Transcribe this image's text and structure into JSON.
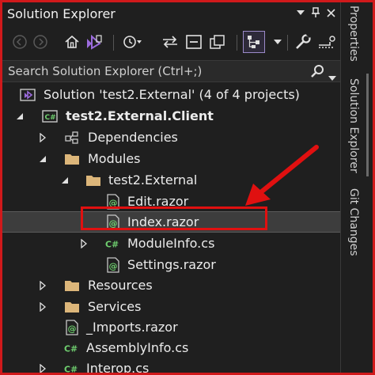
{
  "panel": {
    "title": "Solution Explorer",
    "search": {
      "placeholder": "Search Solution Explorer (Ctrl+;)"
    }
  },
  "toolbar": {
    "buttons": [
      "back-icon",
      "forward-icon",
      "home-icon",
      "switch-views-icon",
      "history-icon",
      "sync-icon",
      "collapse-all-icon",
      "show-all-files-icon",
      "preview-icon",
      "properties-wrench-icon",
      "settings-icon"
    ]
  },
  "tree": {
    "solution": "Solution 'test2.External' (4 of 4 projects)",
    "project": "test2.External.Client",
    "dependencies": "Dependencies",
    "modules": "Modules",
    "module_folder": "test2.External",
    "edit": "Edit.razor",
    "index": "Index.razor",
    "moduleinfo": "ModuleInfo.cs",
    "settings": "Settings.razor",
    "resources": "Resources",
    "services": "Services",
    "imports": "_Imports.razor",
    "assemblyinfo": "AssemblyInfo.cs",
    "interop": "Interop.cs"
  },
  "side_tabs": {
    "properties": "Properties",
    "solution_explorer": "Solution Explorer",
    "git_changes": "Git Changes"
  },
  "colors": {
    "background": "#1f1f1f",
    "folder": "#dcb67a",
    "csharp": "#6fcf6f",
    "vs_purple": "#9b6bdc",
    "annotation_red": "#e01010"
  }
}
